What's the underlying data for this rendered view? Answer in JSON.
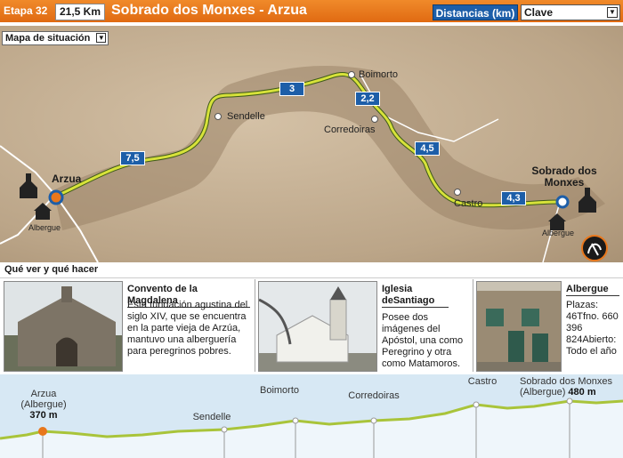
{
  "header": {
    "stage": "Etapa 32",
    "distance": "21,5 Km",
    "title": "Sobrado dos Monxes - Arzua",
    "distances_button": "Distancias (km)",
    "legend_select": "Clave"
  },
  "map": {
    "selector": "Mapa de situación",
    "towns": {
      "arzua": "Arzua",
      "arzua_sub": "Albergue",
      "sendelle": "Sendelle",
      "boimorto": "Boimorto",
      "corredoiras": "Corredoiras",
      "castro": "Castro",
      "sobrado": "Sobrado dos Monxes",
      "sobrado_sub": "Albergue"
    },
    "segments": [
      "7,5",
      "3",
      "2,2",
      "4,5",
      "4,3"
    ]
  },
  "section": {
    "title": "Qué ver y qué hacer"
  },
  "cards": [
    {
      "title": "Convento de la Magdalena",
      "text": "Esta fundación agustina del siglo XIV, que se encuentra en la parte vieja de Arzúa, mantuvo una alberguería para peregrinos pobres."
    },
    {
      "title": "Iglesia deSantiago",
      "text": "Posee dos imágenes del Apóstol, una como Peregrino y otra como Matamoros."
    },
    {
      "title": "Albergue",
      "text": "Plazas: 46Tfno. 660 396 824Abierto: Todo el año"
    }
  ],
  "profile": {
    "points": [
      {
        "name": "Arzua",
        "sub": "(Albergue)",
        "alt": "370 m"
      },
      {
        "name": "Sendelle"
      },
      {
        "name": "Boimorto"
      },
      {
        "name": "Corredoiras"
      },
      {
        "name": "Castro"
      },
      {
        "name": "Sobrado dos Monxes",
        "sub": "(Albergue)",
        "alt": "480 m"
      }
    ]
  },
  "colors": {
    "header": "#e8771c",
    "accent": "#1d5ea8",
    "route": "#d7e23a",
    "profile_bg": "#d7e8f4",
    "profile_line": "#a9c43a"
  }
}
